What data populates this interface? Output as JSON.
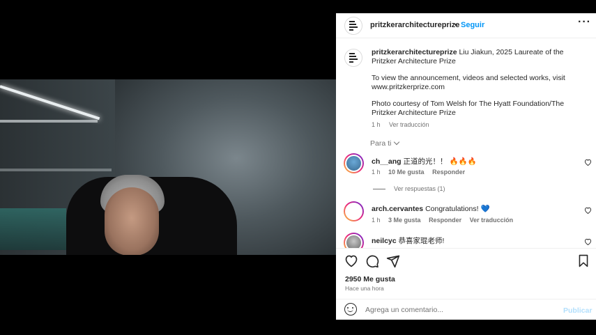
{
  "photo": {
    "description_name": "portrait-photo"
  },
  "header": {
    "username": "pritzkerarchitectureprize",
    "separator": "•",
    "follow_label": "Seguir",
    "more_label": "···"
  },
  "caption": {
    "username": "pritzkerarchitectureprize",
    "line1": "Liu Jiakun, 2025 Laureate of the Pritzker Architecture Prize",
    "line2": "To view the announcement, videos and selected works, visit www.pritzkerprize.com",
    "line3": "Photo courtesy of Tom Welsh for The Hyatt Foundation/The Pritzker Architecture Prize",
    "time": "1 h",
    "translate": "Ver traducción"
  },
  "para_ti": "Para ti",
  "comments": [
    {
      "username": "ch__ang",
      "text": "正道的光！！ 🔥🔥🔥",
      "time": "1 h",
      "likes": "10 Me gusta",
      "reply": "Responder",
      "view_replies": "Ver respuestas (1)"
    },
    {
      "username": "arch.cervantes",
      "text": "Congratulations! 💙",
      "time": "1 h",
      "likes": "3 Me gusta",
      "reply": "Responder",
      "translate": "Ver traducción"
    },
    {
      "username": "neilcyc",
      "text": "恭喜家琨老师!"
    }
  ],
  "actions": {
    "likes": "2950 Me gusta",
    "time": "Hace una hora"
  },
  "add_comment": {
    "placeholder": "Agrega un comentario...",
    "publish_label": "Publicar"
  },
  "colors": {
    "accent": "#0095f6",
    "publish_disabled": "#b2dffc",
    "secondary_text": "#737373"
  }
}
